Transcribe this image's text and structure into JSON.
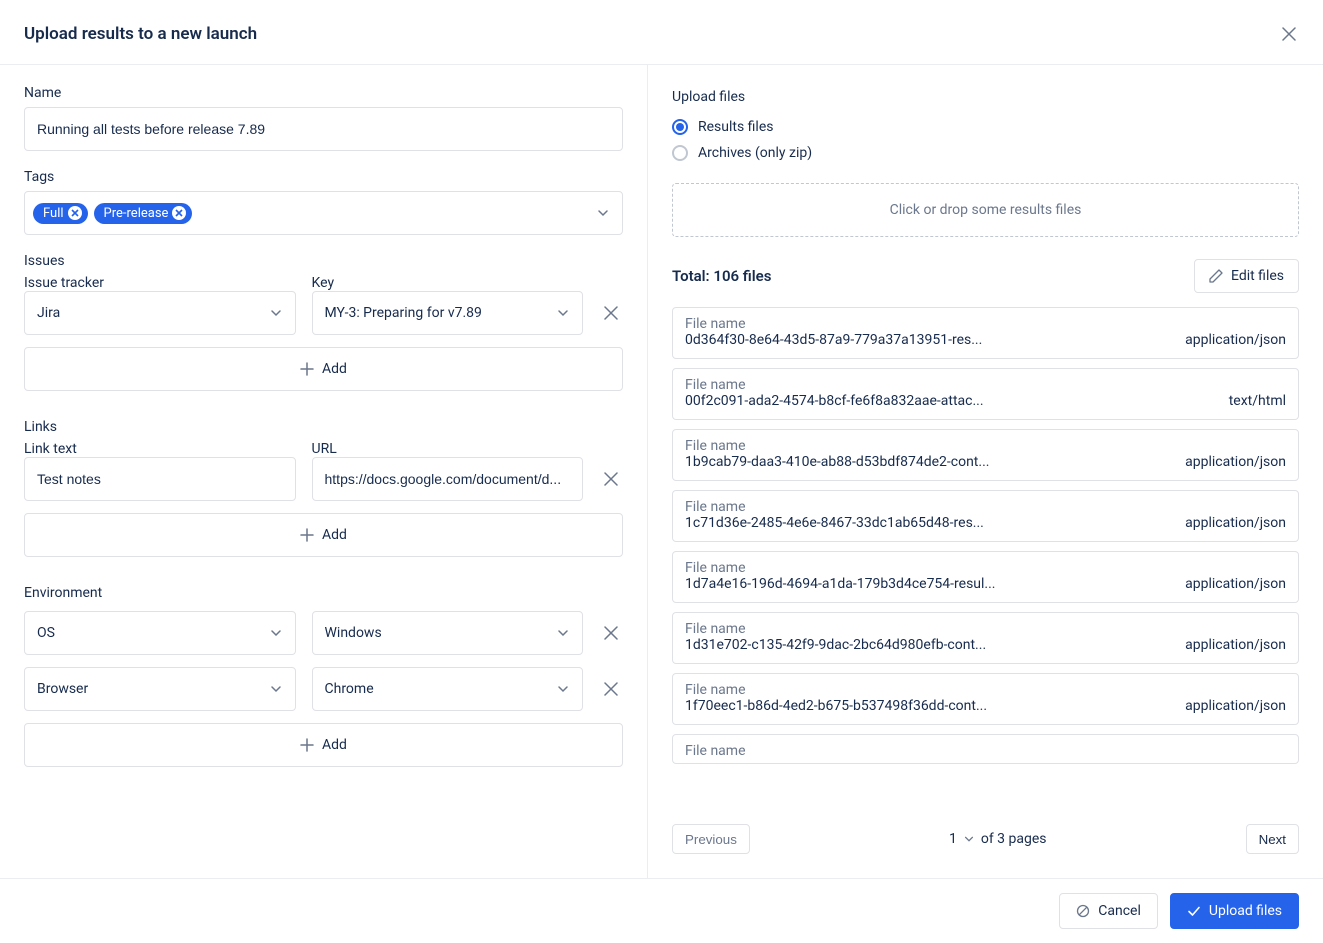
{
  "header": {
    "title": "Upload results to a new launch"
  },
  "left": {
    "name_label": "Name",
    "name_value": "Running all tests before release 7.89",
    "tags_label": "Tags",
    "tags": [
      "Full",
      "Pre-release"
    ],
    "issues": {
      "heading": "Issues",
      "tracker_label": "Issue tracker",
      "tracker_value": "Jira",
      "key_label": "Key",
      "key_value": "MY-3: Preparing for v7.89",
      "add_label": "Add"
    },
    "links": {
      "heading": "Links",
      "text_label": "Link text",
      "text_value": "Test notes",
      "url_label": "URL",
      "url_value": "https://docs.google.com/document/d...",
      "add_label": "Add"
    },
    "env": {
      "heading": "Environment",
      "rows": [
        {
          "key": "OS",
          "value": "Windows"
        },
        {
          "key": "Browser",
          "value": "Chrome"
        }
      ],
      "add_label": "Add"
    }
  },
  "right": {
    "upload_heading": "Upload files",
    "radio_results": "Results files",
    "radio_archives": "Archives (only zip)",
    "dropzone": "Click or drop some results files",
    "total_prefix": "Total: ",
    "total_count": "106 files",
    "edit_files": "Edit files",
    "file_label": "File name",
    "files": [
      {
        "name": "0d364f30-8e64-43d5-87a9-779a37a13951-res...",
        "type": "application/json"
      },
      {
        "name": "00f2c091-ada2-4574-b8cf-fe6f8a832aae-attac...",
        "type": "text/html"
      },
      {
        "name": "1b9cab79-daa3-410e-ab88-d53bdf874de2-cont...",
        "type": "application/json"
      },
      {
        "name": "1c71d36e-2485-4e6e-8467-33dc1ab65d48-res...",
        "type": "application/json"
      },
      {
        "name": "1d7a4e16-196d-4694-a1da-179b3d4ce754-resul...",
        "type": "application/json"
      },
      {
        "name": "1d31e702-c135-42f9-9dac-2bc64d980efb-cont...",
        "type": "application/json"
      },
      {
        "name": "1f70eec1-b86d-4ed2-b675-b537498f36dd-cont...",
        "type": "application/json"
      },
      {
        "name": "",
        "type": ""
      }
    ],
    "pager": {
      "prev": "Previous",
      "current": "1",
      "of_text": "of 3 pages",
      "next": "Next"
    }
  },
  "footer": {
    "cancel": "Cancel",
    "upload": "Upload files"
  }
}
